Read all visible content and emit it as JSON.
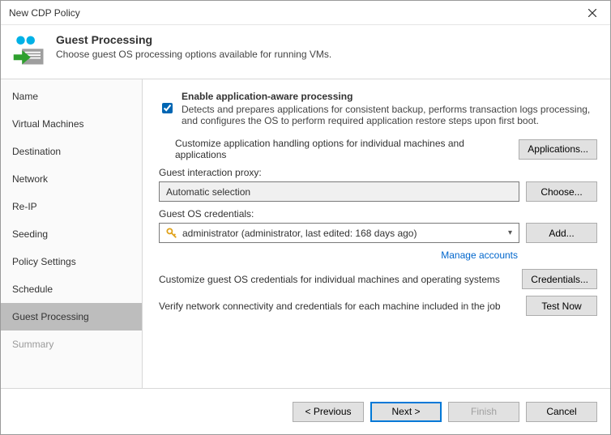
{
  "window": {
    "title": "New CDP Policy"
  },
  "header": {
    "title": "Guest Processing",
    "subtitle": "Choose guest OS processing options available for running VMs."
  },
  "nav": {
    "items": [
      {
        "label": "Name"
      },
      {
        "label": "Virtual Machines"
      },
      {
        "label": "Destination"
      },
      {
        "label": "Network"
      },
      {
        "label": "Re-IP"
      },
      {
        "label": "Seeding"
      },
      {
        "label": "Policy Settings"
      },
      {
        "label": "Schedule"
      },
      {
        "label": "Guest Processing"
      },
      {
        "label": "Summary"
      }
    ]
  },
  "enable_check": {
    "label": "Enable application-aware processing",
    "desc": "Detects and prepares applications for consistent backup, performs transaction logs processing, and configures the OS to perform required application restore steps upon first boot."
  },
  "customize_app_line": "Customize application handling options for individual machines and applications",
  "applications_btn": "Applications...",
  "proxy": {
    "label": "Guest interaction proxy:",
    "value": "Automatic selection",
    "choose_btn": "Choose..."
  },
  "creds": {
    "label": "Guest OS credentials:",
    "value": "administrator (administrator, last edited: 168 days ago)",
    "add_btn": "Add...",
    "manage_link": "Manage accounts"
  },
  "customize_creds_line": "Customize guest OS credentials for individual machines and operating systems",
  "credentials_btn": "Credentials...",
  "verify_line": "Verify network connectivity and credentials for each machine included in the job",
  "test_btn": "Test Now",
  "footer": {
    "previous": "< Previous",
    "next": "Next >",
    "finish": "Finish",
    "cancel": "Cancel"
  }
}
